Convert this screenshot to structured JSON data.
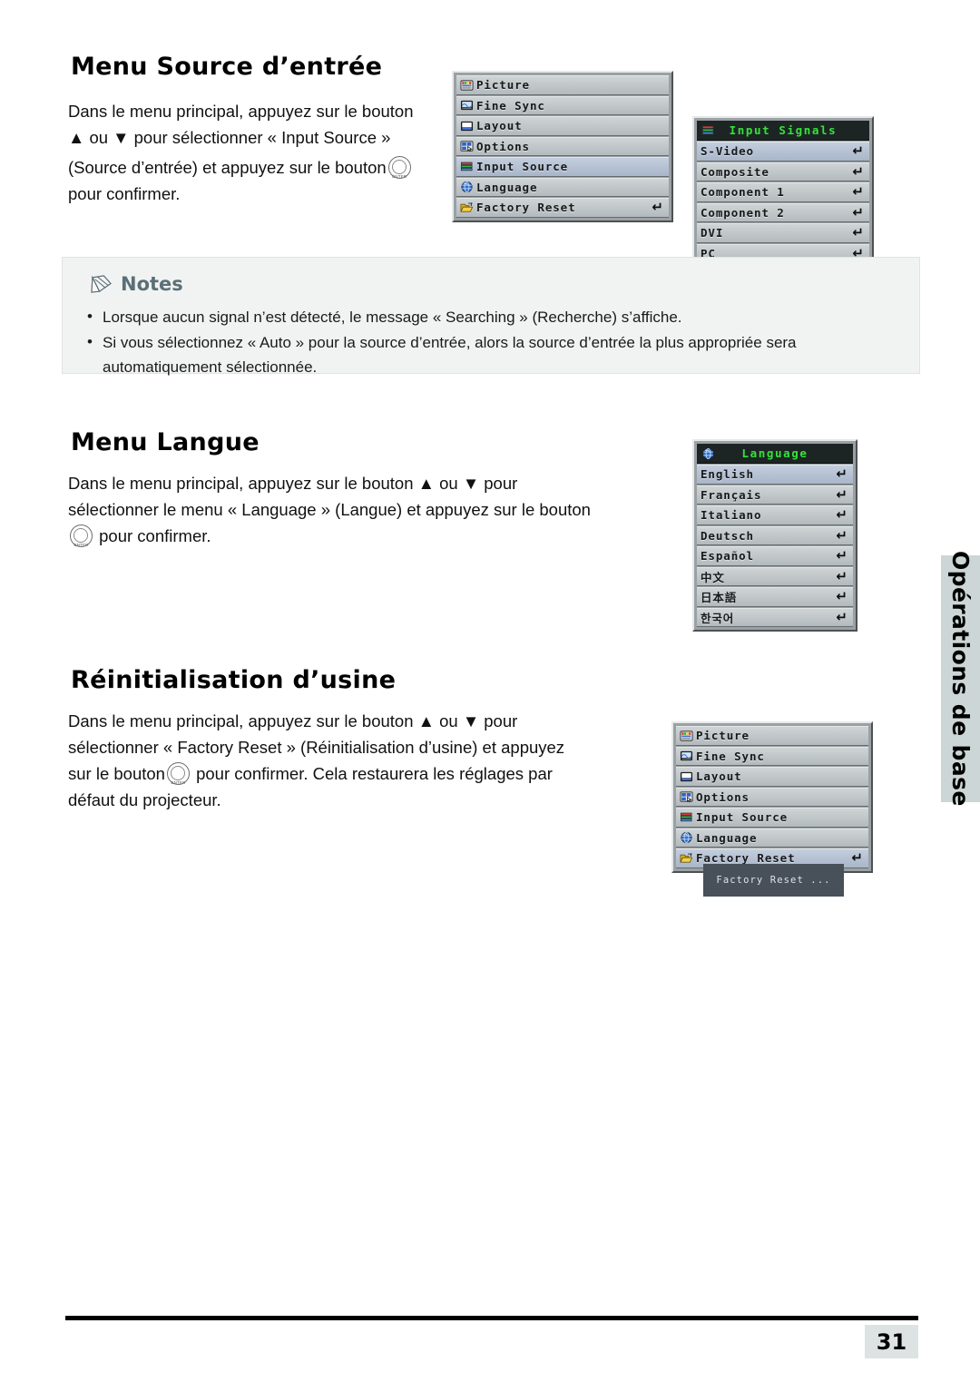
{
  "sections": {
    "input_source": {
      "title": "Menu Source d’entrée",
      "para_line1": "Dans le menu principal, appuyez sur le bouton",
      "para_line2": "▲ ou ▼ pour sélectionner « Input Source »",
      "para_line3_a": "(Source d’entrée) et appuyez sur le bouton",
      "para_line4": "pour confirmer."
    },
    "language": {
      "title": "Menu Langue",
      "para_line1": "Dans le menu principal, appuyez sur le bouton ▲ ou ▼ pour",
      "para_line2": "sélectionner le menu « Language » (Langue) et appuyez sur le bouton",
      "para_line3": "pour confirmer."
    },
    "factory_reset": {
      "title": "Réinitialisation d’usine",
      "para_line1": "Dans le menu principal, appuyez sur le bouton ▲ ou ▼ pour",
      "para_line2": "sélectionner « Factory Reset » (Réinitialisation d’usine) et appuyez",
      "para_line3_a": "sur le bouton",
      "para_line3_b": "pour confirmer. Cela restaurera les réglages par",
      "para_line4": "défaut du projecteur."
    }
  },
  "notes": {
    "title": "Notes",
    "items": [
      "Lorsque aucun signal n’est détecté, le message « Searching » (Recherche) s’affiche.",
      "Si vous sélectionnez « Auto » pour la source d’entrée, alors la source d’entrée la plus appropriée sera automatiquement sélectionnée."
    ]
  },
  "osd_main_menu_top": {
    "items": [
      {
        "label": "Picture",
        "icon": "picture-icon",
        "selected": false,
        "enter": false
      },
      {
        "label": "Fine Sync",
        "icon": "fine-sync-icon",
        "selected": false,
        "enter": false
      },
      {
        "label": "Layout",
        "icon": "layout-icon",
        "selected": false,
        "enter": false
      },
      {
        "label": "Options",
        "icon": "options-icon",
        "selected": false,
        "enter": false
      },
      {
        "label": "Input Source",
        "icon": "input-source-icon",
        "selected": true,
        "enter": false
      },
      {
        "label": "Language",
        "icon": "language-globe-icon",
        "selected": false,
        "enter": false
      },
      {
        "label": "Factory Reset",
        "icon": "factory-reset-icon",
        "selected": false,
        "enter": true
      }
    ],
    "enter_glyph": "↵"
  },
  "osd_input_signals": {
    "header": "Input Signals",
    "header_icon": "input-source-icon",
    "header_text_color": "#35e23a",
    "items": [
      {
        "label": "S-Video",
        "selected": true,
        "enter": true
      },
      {
        "label": "Composite",
        "selected": false,
        "enter": true
      },
      {
        "label": "Component 1",
        "selected": false,
        "enter": true
      },
      {
        "label": "Component 2",
        "selected": false,
        "enter": true
      },
      {
        "label": "DVI",
        "selected": false,
        "enter": true
      },
      {
        "label": "PC",
        "selected": false,
        "enter": true
      }
    ]
  },
  "osd_language_menu": {
    "header": "Language",
    "header_icon": "language-globe-icon",
    "header_text_color": "#35e23a",
    "items": [
      {
        "label": "English",
        "selected": true,
        "enter": true
      },
      {
        "label": "Français",
        "selected": false,
        "enter": true
      },
      {
        "label": "Italiano",
        "selected": false,
        "enter": true
      },
      {
        "label": "Deutsch",
        "selected": false,
        "enter": true
      },
      {
        "label": "Español",
        "selected": false,
        "enter": true
      },
      {
        "label": "中文",
        "selected": false,
        "enter": true
      },
      {
        "label": "日本語",
        "selected": false,
        "enter": true
      },
      {
        "label": "한국어",
        "selected": false,
        "enter": true
      }
    ]
  },
  "osd_main_menu_bottom": {
    "items": [
      {
        "label": "Picture",
        "icon": "picture-icon",
        "selected": false,
        "enter": false
      },
      {
        "label": "Fine Sync",
        "icon": "fine-sync-icon",
        "selected": false,
        "enter": false
      },
      {
        "label": "Layout",
        "icon": "layout-icon",
        "selected": false,
        "enter": false
      },
      {
        "label": "Options",
        "icon": "options-icon",
        "selected": false,
        "enter": false
      },
      {
        "label": "Input Source",
        "icon": "input-source-icon",
        "selected": false,
        "enter": false
      },
      {
        "label": "Language",
        "icon": "language-globe-icon",
        "selected": false,
        "enter": false
      },
      {
        "label": "Factory Reset",
        "icon": "factory-reset-icon",
        "selected": true,
        "enter": true
      }
    ],
    "toast": "Factory Reset ..."
  },
  "side_tab": {
    "label": "Opérations de base"
  },
  "footer": {
    "page_number": "31"
  },
  "colors": {
    "osd_header_bg": "#1d2524",
    "osd_green": "#35e23a",
    "osd_row": "#c5cbce",
    "osd_row_selected": "#b6c2d3",
    "notes_bg": "#f1f3f3",
    "notes_title": "#5b6f77",
    "side_tab_bg": "#ccd6d6",
    "page_num_bg": "#dde3e3"
  }
}
